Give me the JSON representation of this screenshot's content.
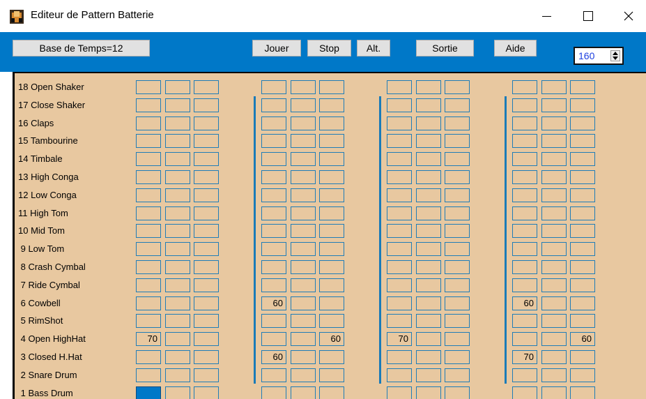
{
  "window": {
    "title": "Editeur de Pattern Batterie",
    "controls": [
      "minimize",
      "maximize",
      "close"
    ]
  },
  "toolbar": {
    "timebase_label": "Base de Temps=12",
    "play_label": "Jouer",
    "stop_label": "Stop",
    "alt_label": "Alt.",
    "exit_label": "Sortie",
    "help_label": "Aide",
    "tempo_value": "160"
  },
  "colors": {
    "toolbar_bg": "#0078c8",
    "grid_bg": "#e8c8a0",
    "cell_border": "#1f7db8",
    "selected_cell": "#0078c8",
    "tempo_text": "#1e40e0"
  },
  "instruments": [
    "18 Open Shaker",
    "17 Close Shaker",
    "16 Claps",
    "15 Tambourine",
    "14 Timbale",
    "13 High Conga",
    "12 Low Conga",
    "11 High Tom",
    "10 Mid Tom",
    " 9 Low Tom",
    " 8 Crash Cymbal",
    " 7 Ride Cymbal",
    " 6 Cowbell",
    " 5 RimShot",
    " 4 Open HighHat",
    " 3 Closed H.Hat",
    " 2 Snare Drum",
    " 1 Bass Drum"
  ],
  "grid": {
    "beats": 4,
    "steps_per_beat": 3,
    "rows": [
      [
        "",
        "",
        "",
        "",
        "",
        "",
        "",
        "",
        "",
        "",
        "",
        ""
      ],
      [
        "",
        "",
        "",
        "",
        "",
        "",
        "",
        "",
        "",
        "",
        "",
        ""
      ],
      [
        "",
        "",
        "",
        "",
        "",
        "",
        "",
        "",
        "",
        "",
        "",
        ""
      ],
      [
        "",
        "",
        "",
        "",
        "",
        "",
        "",
        "",
        "",
        "",
        "",
        ""
      ],
      [
        "",
        "",
        "",
        "",
        "",
        "",
        "",
        "",
        "",
        "",
        "",
        ""
      ],
      [
        "",
        "",
        "",
        "",
        "",
        "",
        "",
        "",
        "",
        "",
        "",
        ""
      ],
      [
        "",
        "",
        "",
        "",
        "",
        "",
        "",
        "",
        "",
        "",
        "",
        ""
      ],
      [
        "",
        "",
        "",
        "",
        "",
        "",
        "",
        "",
        "",
        "",
        "",
        ""
      ],
      [
        "",
        "",
        "",
        "",
        "",
        "",
        "",
        "",
        "",
        "",
        "",
        ""
      ],
      [
        "",
        "",
        "",
        "",
        "",
        "",
        "",
        "",
        "",
        "",
        "",
        ""
      ],
      [
        "",
        "",
        "",
        "",
        "",
        "",
        "",
        "",
        "",
        "",
        "",
        ""
      ],
      [
        "",
        "",
        "",
        "",
        "",
        "",
        "",
        "",
        "",
        "",
        "",
        ""
      ],
      [
        "",
        "",
        "",
        "60",
        "",
        "",
        "",
        "",
        "",
        "60",
        "",
        ""
      ],
      [
        "",
        "",
        "",
        "",
        "",
        "",
        "",
        "",
        "",
        "",
        "",
        ""
      ],
      [
        "70",
        "",
        "",
        "",
        "",
        "60",
        "70",
        "",
        "",
        "",
        "",
        "60"
      ],
      [
        "",
        "",
        "",
        "60",
        "",
        "",
        "",
        "",
        "",
        "70",
        "",
        ""
      ],
      [
        "",
        "",
        "",
        "",
        "",
        "",
        "",
        "",
        "",
        "",
        "",
        ""
      ],
      [
        "",
        "",
        "",
        "",
        "",
        "",
        "",
        "",
        "",
        "",
        "",
        ""
      ]
    ],
    "selected": {
      "row": 17,
      "col": 0
    }
  }
}
